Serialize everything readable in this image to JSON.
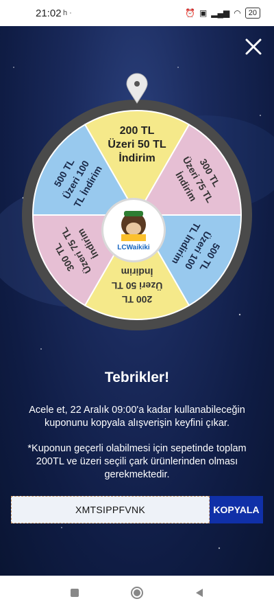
{
  "status_bar": {
    "time": "21:02",
    "left_icons": "h  ·",
    "battery": "20"
  },
  "wheel": {
    "segments": [
      {
        "lines": [
          "200 TL",
          "Üzeri 50 TL",
          "İndirim"
        ],
        "color": "#f5e98a",
        "text_color": "#222222"
      },
      {
        "lines": [
          "300 TL",
          "Üzeri 75 TL",
          "İndirim"
        ],
        "color": "#e6bfd4",
        "text_color": "#333333"
      },
      {
        "lines": [
          "500 TL",
          "Üzeri 100",
          "TL İndirim"
        ],
        "color": "#98c9ee",
        "text_color": "#1a2a4a"
      },
      {
        "lines": [
          "200 TL",
          "Üzeri 50 TL",
          "İndirim"
        ],
        "color": "#f5e98a",
        "text_color": "#333333"
      },
      {
        "lines": [
          "300 TL",
          "Üzeri 75 TL",
          "İndirim"
        ],
        "color": "#e6bfd4",
        "text_color": "#333333"
      },
      {
        "lines": [
          "500 TL",
          "Üzeri 100",
          "TL İndirim"
        ],
        "color": "#98c9ee",
        "text_color": "#1a2a4a"
      }
    ],
    "logo_text": "LCWaikiki"
  },
  "result": {
    "title": "Tebrikler!",
    "description": "Acele et, 22 Aralık 09:00'a kadar kullanabileceğin kuponunu kopyala alışverişin keyfini çıkar.",
    "note": "*Kuponun geçerli olabilmesi için sepetinde toplam 200TL ve üzeri seçili çark ürünlerinden olması gerekmektedir."
  },
  "coupon": {
    "code": "XMTSIPPFVNK",
    "copy_label": "KOPYALA"
  },
  "colors": {
    "accent": "#1030a8",
    "background": "#0f1c44",
    "rim": "#4a4a4a"
  },
  "icons": {
    "close": "close-icon",
    "pin": "location-pin-icon",
    "nav": [
      "stop-square-icon",
      "home-circle-icon",
      "back-triangle-icon"
    ]
  }
}
